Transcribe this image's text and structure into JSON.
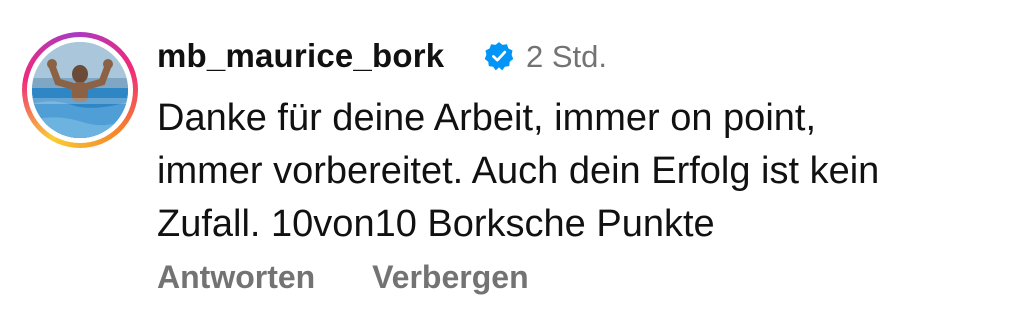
{
  "comment": {
    "username": "mb_maurice_bork",
    "verified_icon": "verified-badge-icon",
    "timestamp": "2 Std.",
    "text_lines": [
      "Danke für deine Arbeit, immer on point,",
      "immer vorbereitet. Auch dein Erfolg ist kein",
      "Zufall. 10von10 Borksche Punkte"
    ],
    "actions": {
      "reply_label": "Antworten",
      "hide_label": "Verbergen"
    }
  },
  "colors": {
    "text": "#111111",
    "secondary_text": "#737373",
    "verified_blue": "#0095f6",
    "story_ring": [
      "#f9ce34",
      "#ee2a7b",
      "#a83ac4",
      "#f58529"
    ]
  }
}
